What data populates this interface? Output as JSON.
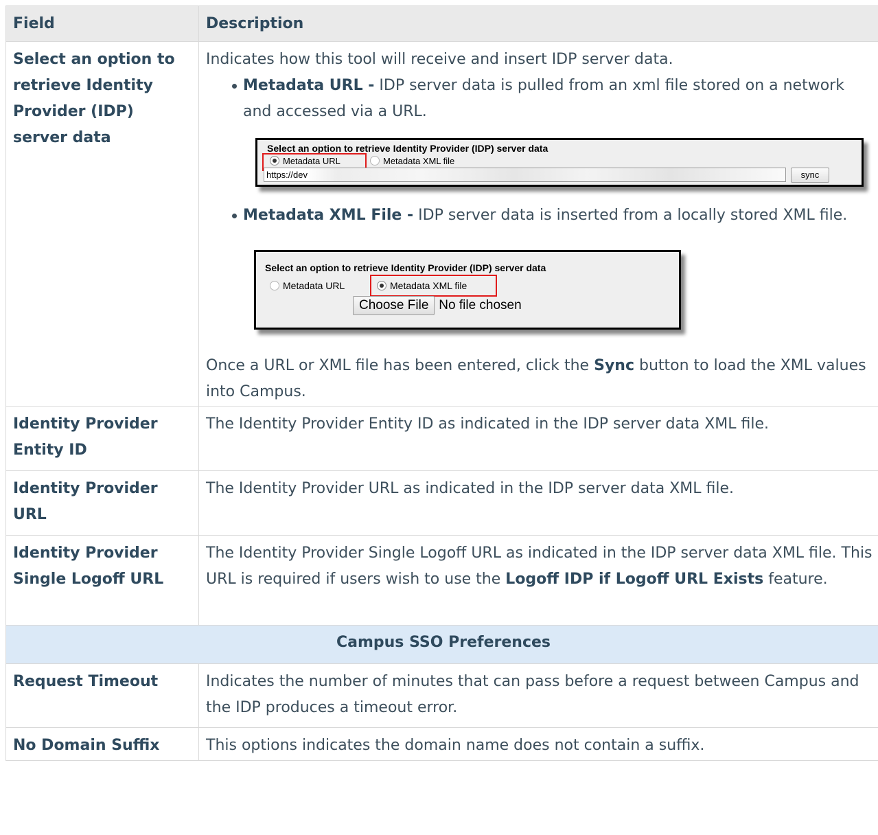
{
  "header": {
    "field": "Field",
    "description": "Description"
  },
  "row1": {
    "field": "Select an option to retrieve Identity Provider (IDP) server data",
    "intro": "Indicates how this tool will receive and insert IDP server data.",
    "bullet1": {
      "title": "Metadata URL -",
      "text": " IDP server data is pulled from an xml file stored on a network and accessed via a URL."
    },
    "shot1": {
      "title": "Select an option to retrieve Identity Provider (IDP) server data",
      "opt1": "Metadata URL",
      "opt2": "Metadata XML file",
      "url_value": "https://dev",
      "sync": "sync"
    },
    "bullet2": {
      "title": "Metadata XML File -",
      "text": " IDP server data is inserted from a locally stored XML file."
    },
    "shot2": {
      "title": "Select an option to retrieve Identity Provider (IDP) server data",
      "opt1": "Metadata URL",
      "opt2": "Metadata XML file",
      "choose": "Choose File",
      "nofile": "No file chosen"
    },
    "outro_pre": "Once a URL or XML file has been entered, click the ",
    "outro_bold": "Sync",
    "outro_post": " button to load the XML values into Campus."
  },
  "row2": {
    "field": "Identity Provider Entity ID",
    "desc": "The Identity Provider Entity ID as indicated in the IDP server data XML file."
  },
  "row3": {
    "field": "Identity Provider URL",
    "desc": "The Identity Provider URL as indicated in the IDP server data XML file."
  },
  "row4": {
    "field": "Identity Provider Single Logoff URL",
    "desc_pre": "The Identity Provider Single Logoff URL as indicated in the IDP server data XML file. This URL is required if users wish to use the ",
    "desc_bold": "Logoff IDP if Logoff URL Exists",
    "desc_post": " feature."
  },
  "section": "Campus SSO Preferences",
  "row5": {
    "field": "Request Timeout",
    "desc": "Indicates the number of minutes that can pass before a request between Campus and the IDP produces a timeout error."
  },
  "row6": {
    "field": "No Domain Suffix",
    "desc": "This options indicates the domain name does not contain a suffix."
  }
}
